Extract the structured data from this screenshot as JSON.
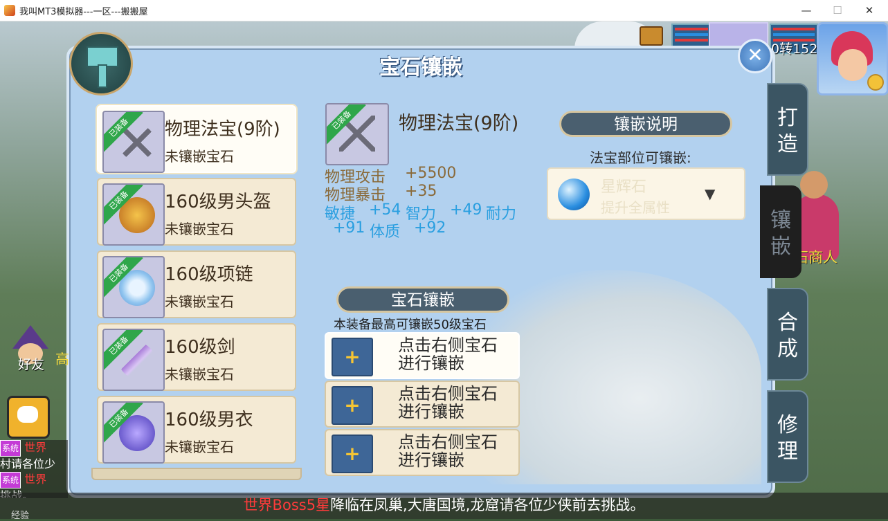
{
  "window": {
    "title": "我叫MT3模拟器---一区---搬搬屋",
    "min": "—",
    "max": "☐",
    "close": "✕"
  },
  "panel": {
    "title": "宝石镶嵌",
    "close": "✕"
  },
  "hud": {
    "level_text": "0转152",
    "merchant_label": "宝石商人",
    "friend_label": "好友",
    "high_label": "高",
    "exp_label": "经验"
  },
  "items": [
    {
      "name": "物理法宝(9阶)",
      "status": "未镶嵌宝石",
      "badge": "已装备",
      "color": "#9a9aa8"
    },
    {
      "name": "160级男头盔",
      "status": "未镶嵌宝石",
      "badge": "已装备",
      "color": "#d4902a"
    },
    {
      "name": "160级项链",
      "status": "未镶嵌宝石",
      "badge": "已装备",
      "color": "#9ac8f0"
    },
    {
      "name": "160级剑",
      "status": "未镶嵌宝石",
      "badge": "已装备",
      "color": "#a77ad8"
    },
    {
      "name": "160级男衣",
      "status": "未镶嵌宝石",
      "badge": "已装备",
      "color": "#6a5ad8"
    }
  ],
  "detail": {
    "name": "物理法宝(9阶)",
    "badge": "已装备",
    "stats": {
      "atk_label": "物理攻击",
      "atk_value": "+5500",
      "crit_label": "物理暴击",
      "crit_value": "+35",
      "agi_label": "敏捷",
      "agi_value": "+54",
      "int_label": "智力",
      "int_value": "+49",
      "sta_label": "耐力",
      "sta_value": "+91",
      "con_label": "体质",
      "con_value": "+92"
    }
  },
  "inlay_info": {
    "banner": "镶嵌说明",
    "slot_desc": "法宝部位可镶嵌:",
    "gem_name": "星辉石",
    "gem_desc": "提升全属性",
    "arrow": "▼"
  },
  "gem_slots": {
    "banner": "宝石镶嵌",
    "max_note": "本装备最高可镶嵌50级宝石",
    "slots": [
      {
        "line1": "点击右侧宝石",
        "line2": "进行镶嵌",
        "plus": "+"
      },
      {
        "line1": "点击右侧宝石",
        "line2": "进行镶嵌",
        "plus": "+"
      },
      {
        "line1": "点击右侧宝石",
        "line2": "进行镶嵌",
        "plus": "+"
      }
    ]
  },
  "side_tabs": [
    {
      "line1": "打",
      "line2": "造"
    },
    {
      "line1": "镶",
      "line2": "嵌"
    },
    {
      "line1": "合",
      "line2": "成"
    },
    {
      "line1": "修",
      "line2": "理"
    }
  ],
  "chat": {
    "lines": [
      {
        "tag": "系统",
        "channel": "世界",
        "text": "村请各位少"
      },
      {
        "tag": "系统",
        "channel": "世界",
        "text": "挑战。"
      }
    ]
  },
  "marquee": {
    "highlight": "世界Boss5星",
    "text": "降临在凤巢,大唐国境,龙窟请各位少侠前去挑战。"
  },
  "colors": {
    "panel_bg": "#b2d1ef",
    "card_bg": "#f4ead4",
    "stat_brown": "#8a6a3a",
    "stat_blue": "#2a9fe0",
    "tab_bg": "#3b5563"
  }
}
